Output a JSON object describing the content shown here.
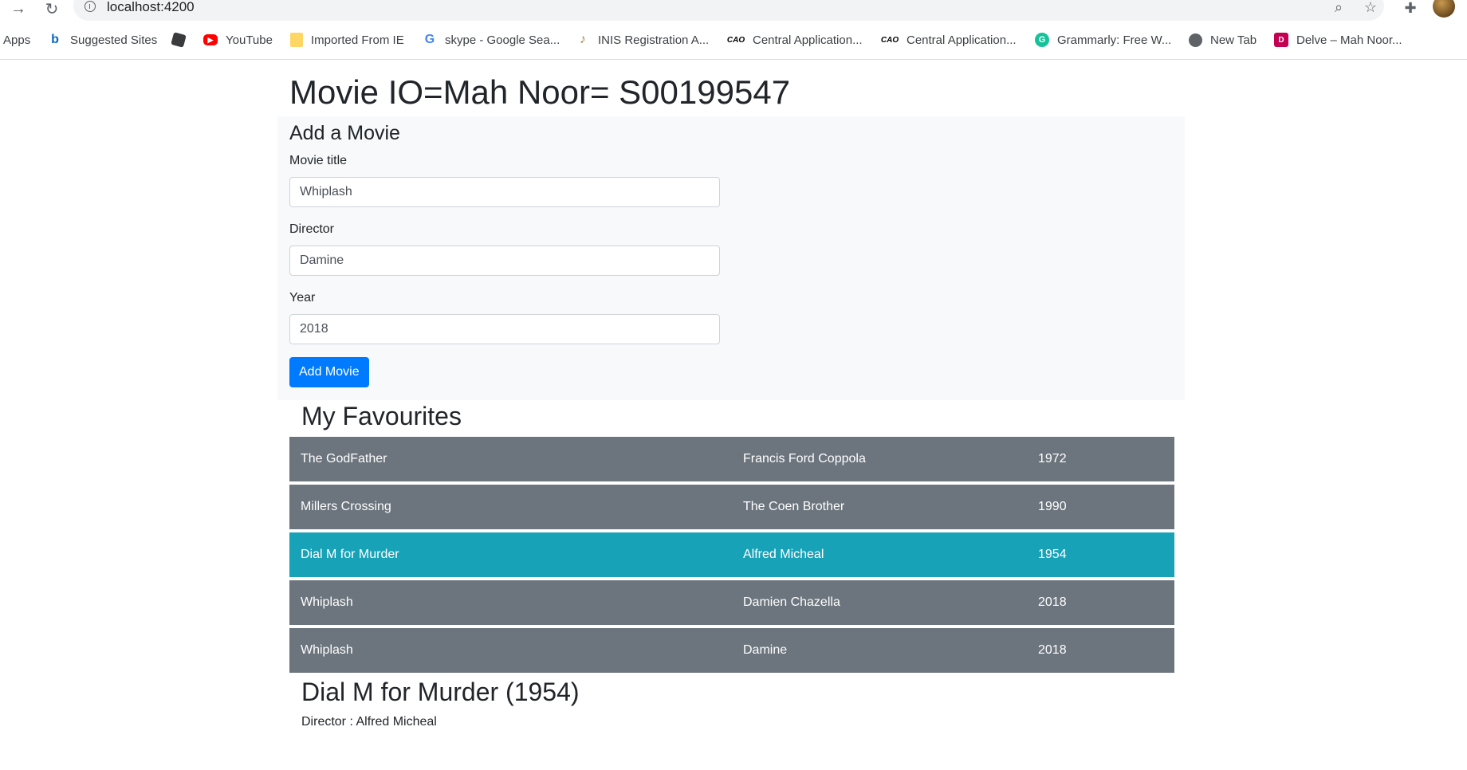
{
  "browser": {
    "url": "localhost:4200",
    "bookmarks": [
      {
        "label": "Apps",
        "icon": "apps-grid-icon"
      },
      {
        "label": "Suggested Sites",
        "icon": "bing-icon"
      },
      {
        "label": "",
        "icon": "roblox-icon"
      },
      {
        "label": "YouTube",
        "icon": "youtube-icon"
      },
      {
        "label": "Imported From IE",
        "icon": "folder-icon"
      },
      {
        "label": "skype - Google Sea...",
        "icon": "google-icon"
      },
      {
        "label": "INIS Registration A...",
        "icon": "harp-icon"
      },
      {
        "label": "Central Application...",
        "icon": "cao-icon",
        "badge": "CAO"
      },
      {
        "label": "Central Application...",
        "icon": "cao-icon",
        "badge": "CAO"
      },
      {
        "label": "Grammarly: Free W...",
        "icon": "grammarly-icon"
      },
      {
        "label": "New Tab",
        "icon": "globe-icon"
      },
      {
        "label": "Delve – Mah Noor...",
        "icon": "delve-icon"
      }
    ]
  },
  "page": {
    "title": "Movie IO=Mah Noor= S00199547"
  },
  "form": {
    "heading": "Add a Movie",
    "title_label": "Movie title",
    "title_value": "Whiplash",
    "director_label": "Director",
    "director_value": "Damine",
    "year_label": "Year",
    "year_value": "2018",
    "submit_label": "Add Movie"
  },
  "favourites": {
    "heading": "My Favourites",
    "movies": [
      {
        "title": "The GodFather",
        "director": "Francis Ford Coppola",
        "year": "1972",
        "selected": false
      },
      {
        "title": "Millers Crossing",
        "director": "The Coen Brother",
        "year": "1990",
        "selected": false
      },
      {
        "title": "Dial M for Murder",
        "director": "Alfred Micheal",
        "year": "1954",
        "selected": true
      },
      {
        "title": "Whiplash",
        "director": "Damien Chazella",
        "year": "2018",
        "selected": false
      },
      {
        "title": "Whiplash",
        "director": "Damine",
        "year": "2018",
        "selected": false
      }
    ]
  },
  "detail": {
    "title": "Dial M for Murder (1954)",
    "director_line": "Director : Alfred Micheal"
  },
  "colors": {
    "row_default": "#6c757d",
    "row_selected": "#17a2b8",
    "primary_button": "#007bff"
  }
}
